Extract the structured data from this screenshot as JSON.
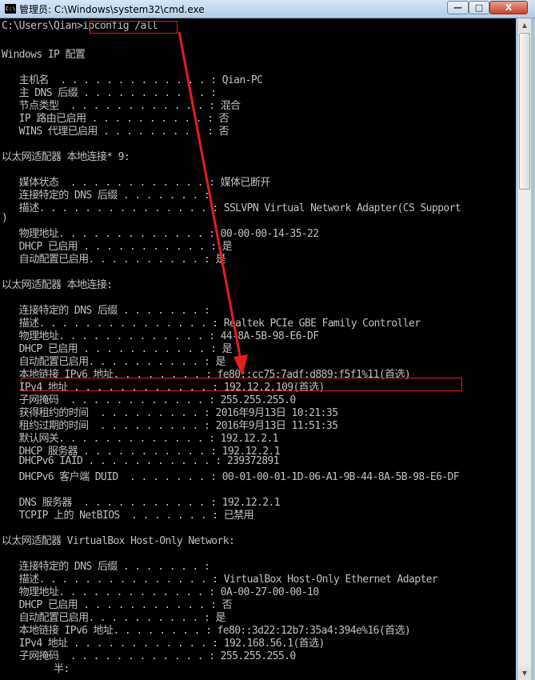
{
  "window": {
    "title": "管理员: C:\\Windows\\system32\\cmd.exe",
    "icon_text": "C:\\",
    "buttons": {
      "minimize": "—",
      "maximize": "□",
      "close": "X"
    }
  },
  "console": {
    "lines": [
      "C:\\Users\\Qian>ipconfig /all",
      "",
      "Windows IP 配置",
      "",
      "   主机名  . . . . . . . . . . . . . : Qian-PC",
      "   主 DNS 后缀 . . . . . . . . . . . :",
      "   节点类型  . . . . . . . . . . . . : 混合",
      "   IP 路由已启用 . . . . . . . . . . : 否",
      "   WINS 代理已启用 . . . . . . . . . : 否",
      "",
      "以太网适配器 本地连接* 9:",
      "",
      "   媒体状态  . . . . . . . . . . . . : 媒体已断开",
      "   连接特定的 DNS 后缀 . . . . . . . :",
      "   描述. . . . . . . . . . . . . . . : SSLVPN Virtual Network Adapter(CS Support",
      ")",
      "   物理地址. . . . . . . . . . . . . : 00-00-00-14-35-22",
      "   DHCP 已启用 . . . . . . . . . . . : 是",
      "   自动配置已启用. . . . . . . . . . : 是",
      "",
      "以太网适配器 本地连接:",
      "",
      "   连接特定的 DNS 后缀 . . . . . . . :",
      "   描述. . . . . . . . . . . . . . . : Realtek PCIe GBE Family Controller",
      "   物理地址. . . . . . . . . . . . . : 44-8A-5B-98-E6-DF",
      "   DHCP 已启用 . . . . . . . . . . . : 是",
      "   自动配置已启用. . . . . . . . . . : 是",
      "   本地链接 IPv6 地址. . . . . . . . : fe80::cc75:7adf:d889:f5f1%11(首选)",
      "   IPv4 地址 . . . . . . . . . . . . : 192.12.2.109(首选)",
      "   子网掩码  . . . . . . . . . . . . : 255.255.255.0",
      "   获得租约的时间  . . . . . . . . . : 2016年9月13日 10:21:35",
      "   租约过期的时间  . . . . . . . . . : 2016年9月13日 11:51:35",
      "   默认网关. . . . . . . . . . . . . : 192.12.2.1",
      "   DHCP 服务器 . . . . . . . . . . . : 192.12.2.1",
      "   DHCPv6 IAID . . . . . . . . . . . : 239372891",
      "   DHCPv6 客户端 DUID  . . . . . . . : 00-01-00-01-1D-06-A1-9B-44-8A-5B-98-E6-DF",
      "",
      "   DNS 服务器  . . . . . . . . . . . : 192.12.2.1",
      "   TCPIP 上的 NetBIOS  . . . . . . . : 已禁用",
      "",
      "以太网适配器 VirtualBox Host-Only Network:",
      "",
      "   连接特定的 DNS 后缀 . . . . . . . :",
      "   描述. . . . . . . . . . . . . . . : VirtualBox Host-Only Ethernet Adapter",
      "   物理地址. . . . . . . . . . . . . : 0A-00-27-00-00-10",
      "   DHCP 已启用 . . . . . . . . . . . : 否",
      "   自动配置已启用. . . . . . . . . . : 是",
      "   本地链接 IPv6 地址. . . . . . . . : fe80::3d22:12b7:35a4:394e%16(首选)",
      "   IPv4 地址 . . . . . . . . . . . . : 192.168.56.1(首选)",
      "   子网掩码  . . . . . . . . . . . . : 255.255.255.0",
      "         半:"
    ]
  },
  "colors": {
    "console_bg": "#000000",
    "console_fg": "#c0c0c0",
    "annotation": "#e02020"
  }
}
